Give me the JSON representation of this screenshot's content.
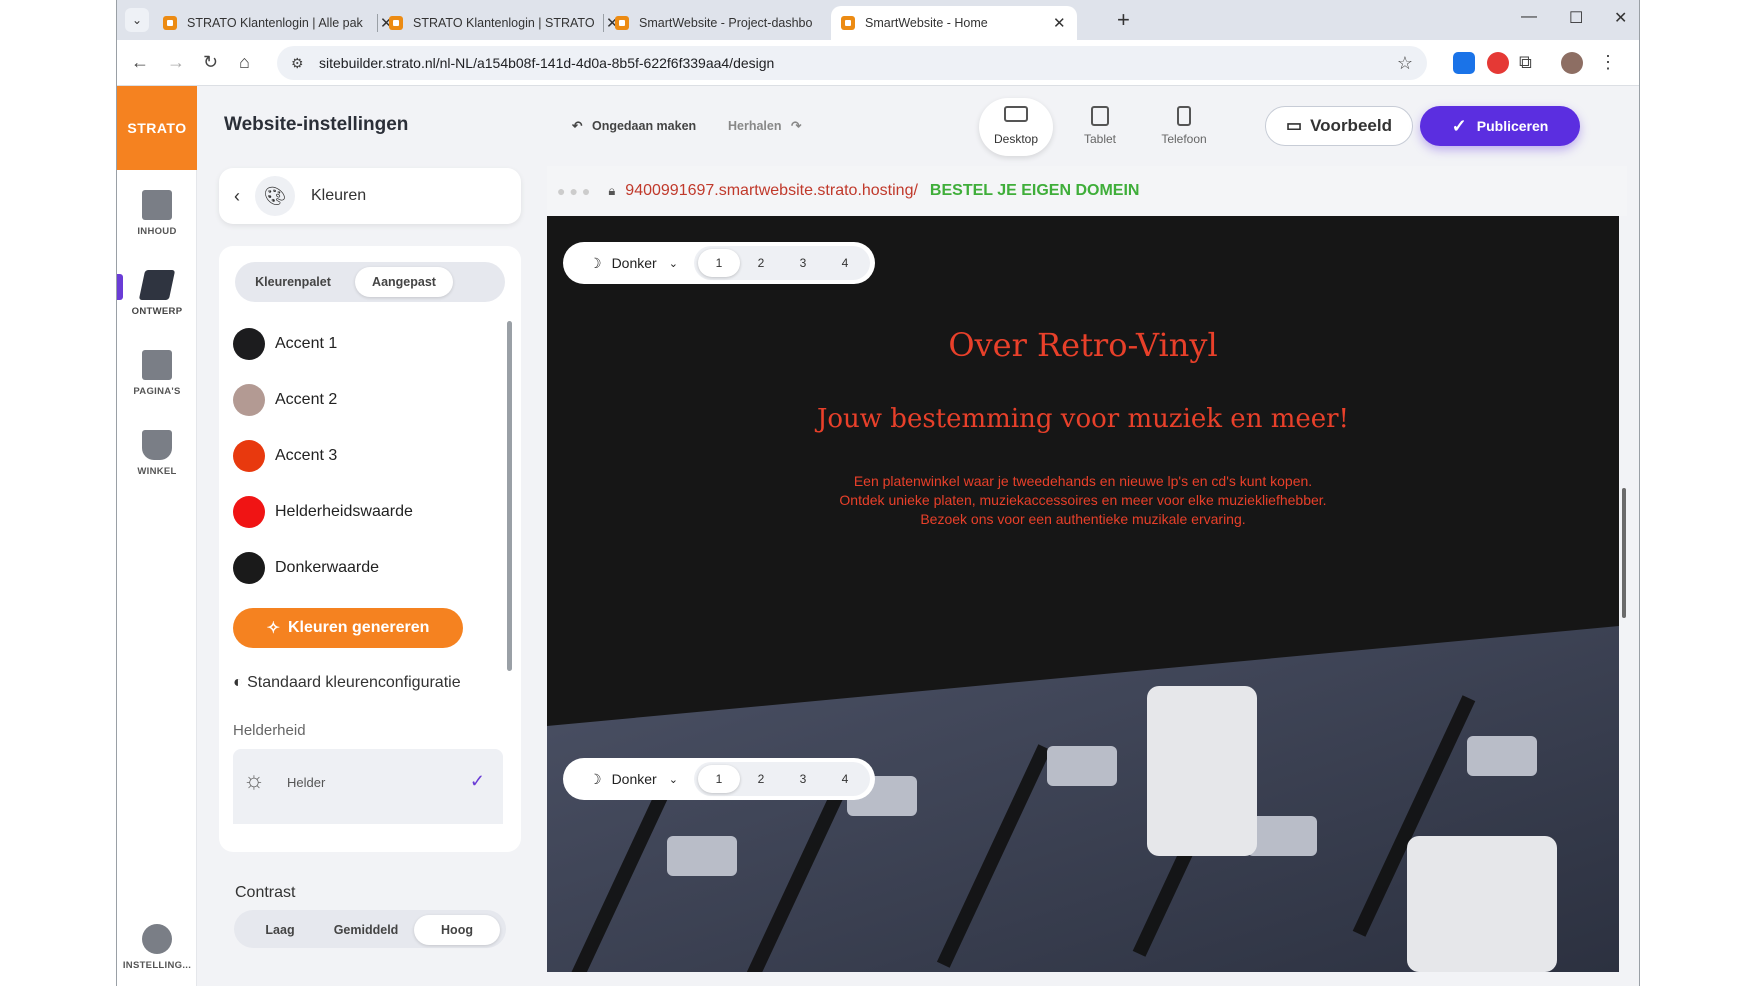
{
  "browser": {
    "tabs": [
      {
        "title": "STRATO Klantenlogin | Alle pak"
      },
      {
        "title": "STRATO Klantenlogin | STRATO"
      },
      {
        "title": "SmartWebsite - Project-dashbo"
      },
      {
        "title": "SmartWebsite - Home"
      }
    ],
    "address": "sitebuilder.strato.nl/nl-NL/a154b08f-141d-4d0a-8b5f-622f6f339aa4/design"
  },
  "rail": {
    "logo": "STRATO",
    "items": [
      {
        "label": "INHOUD",
        "icon": "content-icon"
      },
      {
        "label": "ONTWERP",
        "icon": "design-icon"
      },
      {
        "label": "PAGINA'S",
        "icon": "pages-icon"
      },
      {
        "label": "WINKEL",
        "icon": "cart-icon"
      }
    ],
    "settings": "INSTELLING..."
  },
  "panel": {
    "title": "Website-instellingen",
    "crumb": "Kleuren",
    "tabs": [
      "Kleurenpalet",
      "Aangepast"
    ],
    "colors": [
      {
        "label": "Accent 1",
        "color": "#1c1c1e"
      },
      {
        "label": "Accent 2",
        "color": "#b39a93"
      },
      {
        "label": "Accent 3",
        "color": "#e8390e"
      },
      {
        "label": "Helderheidswaarde",
        "color": "#f01414"
      },
      {
        "label": "Donkerwaarde",
        "color": "#1a1a1a"
      }
    ],
    "generate": "Kleuren genereren",
    "default_config": "Standaard kleurenconfiguratie",
    "brightness_heading": "Helderheid",
    "brightness_option": "Helder",
    "contrast_heading": "Contrast",
    "contrast_options": [
      "Laag",
      "Gemiddeld",
      "Hoog"
    ]
  },
  "toolbar": {
    "undo": "Ongedaan maken",
    "redo": "Herhalen",
    "devices": [
      "Desktop",
      "Tablet",
      "Telefoon"
    ],
    "preview": "Voorbeeld",
    "publish": "Publiceren"
  },
  "site": {
    "url": "9400991697.smartwebsite.strato.hosting/",
    "domain_cta": "BESTEL JE EIGEN DOMEIN",
    "theme": "Donker",
    "variants": [
      "1",
      "2",
      "3",
      "4"
    ],
    "heading": "Over Retro-Vinyl",
    "subheading": "Jouw bestemming voor muziek en meer!",
    "body_lines": [
      "Een platenwinkel waar je tweedehands en nieuwe lp's en cd's kunt kopen.",
      "Ontdek unieke platen, muziekaccessoires en meer voor elke muziekliefhebber.",
      "Bezoek ons voor een authentieke muzikale ervaring."
    ]
  },
  "colors": {
    "accent": "#f58220",
    "primary": "#5b2ee0",
    "heading": "#e8402a"
  }
}
